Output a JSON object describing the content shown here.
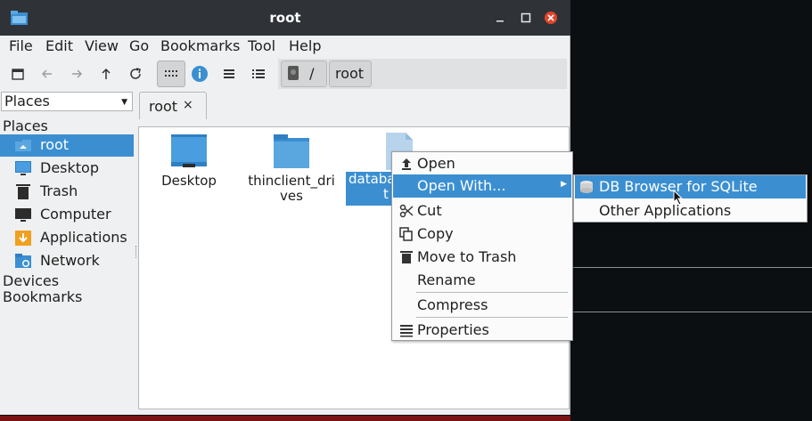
{
  "window": {
    "title": "root"
  },
  "menubar": [
    "File",
    "Edit",
    "View",
    "Go",
    "Bookmarks",
    "Tool",
    "Help"
  ],
  "toolbar": {
    "buttons": [
      "new-window-icon",
      "back-icon",
      "forward-icon",
      "up-icon",
      "reload-icon",
      "icon-view-icon",
      "info-icon",
      "compact-view-icon",
      "list-view-icon"
    ]
  },
  "pathbar": {
    "root": "/",
    "current": "root"
  },
  "side_pane": {
    "mode": "Places"
  },
  "sidebar": {
    "places_heading": "Places",
    "items": [
      {
        "label": "root",
        "icon": "home-folder-icon"
      },
      {
        "label": "Desktop",
        "icon": "desktop-icon"
      },
      {
        "label": "Trash",
        "icon": "trash-icon"
      },
      {
        "label": "Computer",
        "icon": "computer-icon"
      },
      {
        "label": "Applications",
        "icon": "applications-icon"
      },
      {
        "label": "Network",
        "icon": "network-icon"
      }
    ],
    "devices_heading": "Devices",
    "bookmarks_heading": "Bookmarks"
  },
  "tab": {
    "label": "root",
    "close": "×"
  },
  "files": [
    {
      "line1": "Desktop",
      "line2": ""
    },
    {
      "line1": "thinclient_dri",
      "line2": "ves"
    },
    {
      "line1": "databa",
      "line2": "t"
    }
  ],
  "context_menu": {
    "open": "Open",
    "open_with": "Open With...",
    "cut": "Cut",
    "copy": "Copy",
    "move_to_trash": "Move to Trash",
    "rename": "Rename",
    "compress": "Compress",
    "properties": "Properties"
  },
  "submenu": {
    "db_browser": "DB Browser for SQLite",
    "other": "Other Applications"
  },
  "colors": {
    "accent": "#3b8fd1",
    "titlebar": "#2f3338",
    "close": "#e0452c"
  }
}
